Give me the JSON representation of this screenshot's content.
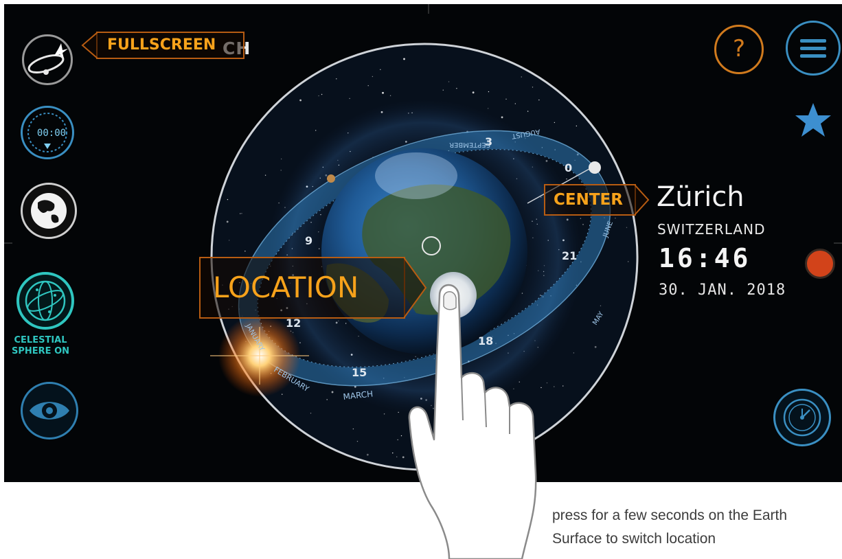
{
  "app": {
    "title_visible_tail": "CH"
  },
  "callouts": {
    "fullscreen": "FULLSCREEN",
    "center": "CENTER",
    "location": "LOCATION"
  },
  "left_toolbar": {
    "clock_readout": "00:00",
    "celestial_sphere_line1": "CELESTIAL",
    "celestial_sphere_line2": "SPHERE ON"
  },
  "right_toolbar": {
    "help_symbol": "?"
  },
  "location_info": {
    "city": "Zürich",
    "country": "SWITZERLAND",
    "time": "16:46",
    "date": "30. JAN. 2018"
  },
  "dial": {
    "month_labels": [
      "MARCH",
      "FEBRUARY",
      "JANUARY",
      "AUGUST",
      "SEPTEMBER",
      "JUNE",
      "MAY"
    ],
    "hour_numerals": [
      "3",
      "0",
      "9",
      "21",
      "12",
      "15",
      "18"
    ]
  },
  "caption": {
    "line1": "press for a few seconds on the Earth",
    "line2": "Surface to switch location"
  },
  "icons": {
    "app_logo": "orbit-logo-icon",
    "clock": "stopwatch-icon",
    "globe": "globe-icon",
    "celestial": "celestial-sphere-icon",
    "eye": "eye-icon",
    "help": "help-icon",
    "menu": "hamburger-menu-icon",
    "favorite": "star-icon",
    "record": "record-dot-icon",
    "watch": "watch-icon"
  },
  "colors": {
    "callout_orange": "#f7a21b",
    "callout_border": "#b85c12",
    "ui_blue": "#3a8fc2",
    "ui_teal": "#2fc6c0",
    "record_red": "#d2431a",
    "star_blue": "#3d8fd0"
  }
}
